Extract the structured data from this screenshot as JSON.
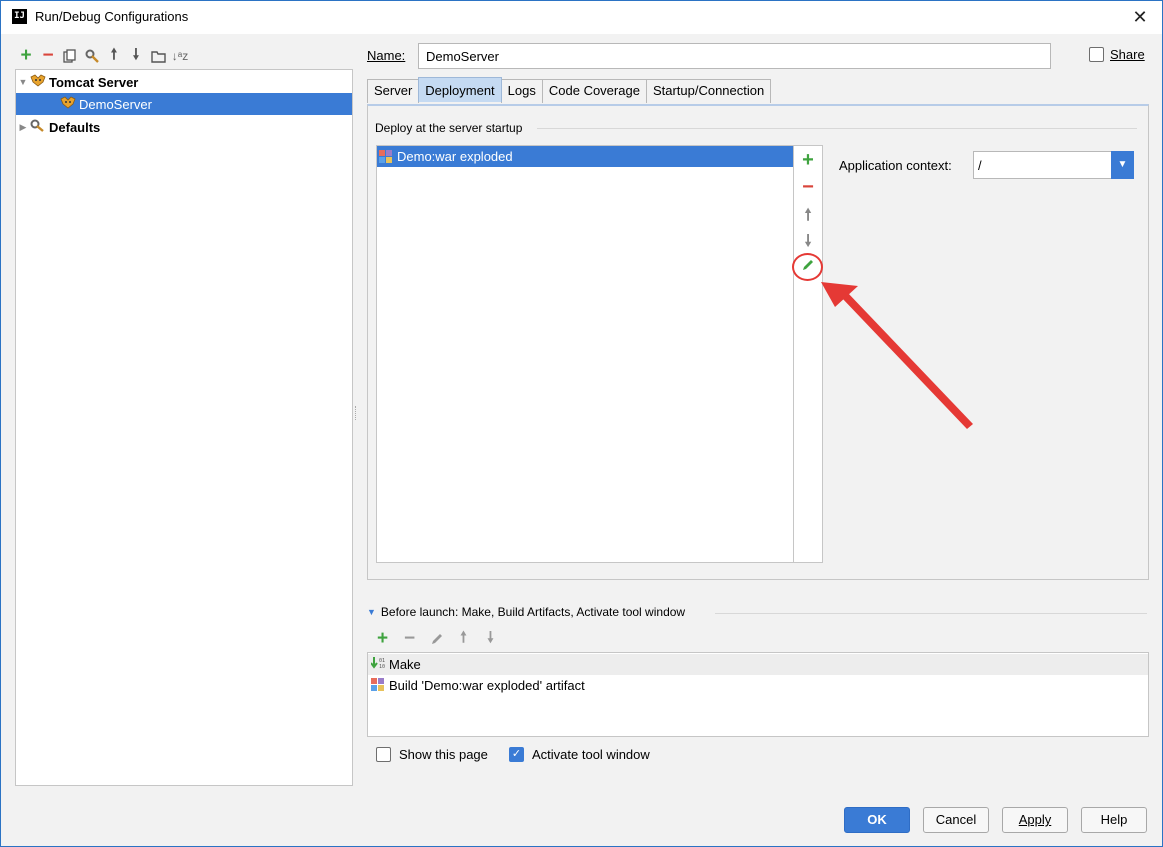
{
  "window": {
    "title": "Run/Debug Configurations",
    "app_icon": "IJ",
    "close_glyph": "✕"
  },
  "left_toolbar": {
    "icons": [
      "add-icon",
      "remove-icon",
      "copy-icon",
      "wrench-icon",
      "move-up-icon",
      "move-down-icon",
      "folder-icon",
      "sort-icon"
    ],
    "glyphs": [
      "+",
      "−",
      "⧉",
      "✎",
      "↑",
      "↓",
      "▭",
      "⇅"
    ]
  },
  "tree": {
    "items": [
      {
        "label": "Tomcat Server",
        "level": 0,
        "expanded": true,
        "bold": true
      },
      {
        "label": "DemoServer",
        "level": 1,
        "selected": true
      },
      {
        "label": "Defaults",
        "level": 0,
        "expanded": false,
        "bold": true
      }
    ]
  },
  "name_field": {
    "label": "Name:",
    "value": "DemoServer"
  },
  "share": {
    "label": "Share",
    "checked": false
  },
  "tabs": [
    "Server",
    "Deployment",
    "Logs",
    "Code Coverage",
    "Startup/Connection"
  ],
  "active_tab": "Deployment",
  "deployment": {
    "section_title": "Deploy at the server startup",
    "items": [
      "Demo:war exploded"
    ],
    "side_tools": [
      "add-icon",
      "remove-icon",
      "move-up-icon",
      "move-down-icon",
      "edit-icon"
    ],
    "context_label": "Application context:",
    "context_value": "/"
  },
  "before_launch": {
    "header": "Before launch: Make, Build Artifacts, Activate tool window",
    "toolbar": [
      "add-icon",
      "remove-icon",
      "edit-icon",
      "move-up-icon",
      "move-down-icon"
    ],
    "items": [
      "Make",
      "Build 'Demo:war exploded' artifact"
    ]
  },
  "options": {
    "show_page": {
      "label": "Show this page",
      "checked": false
    },
    "activate_tool_window": {
      "label": "Activate tool window",
      "checked": true
    }
  },
  "buttons": {
    "ok": "OK",
    "cancel": "Cancel",
    "apply": "Apply",
    "help": "Help"
  },
  "colors": {
    "accent": "#3a7bd5",
    "add_green": "#3fa33f",
    "remove_red": "#d9453b",
    "annotation_red": "#e53935"
  }
}
